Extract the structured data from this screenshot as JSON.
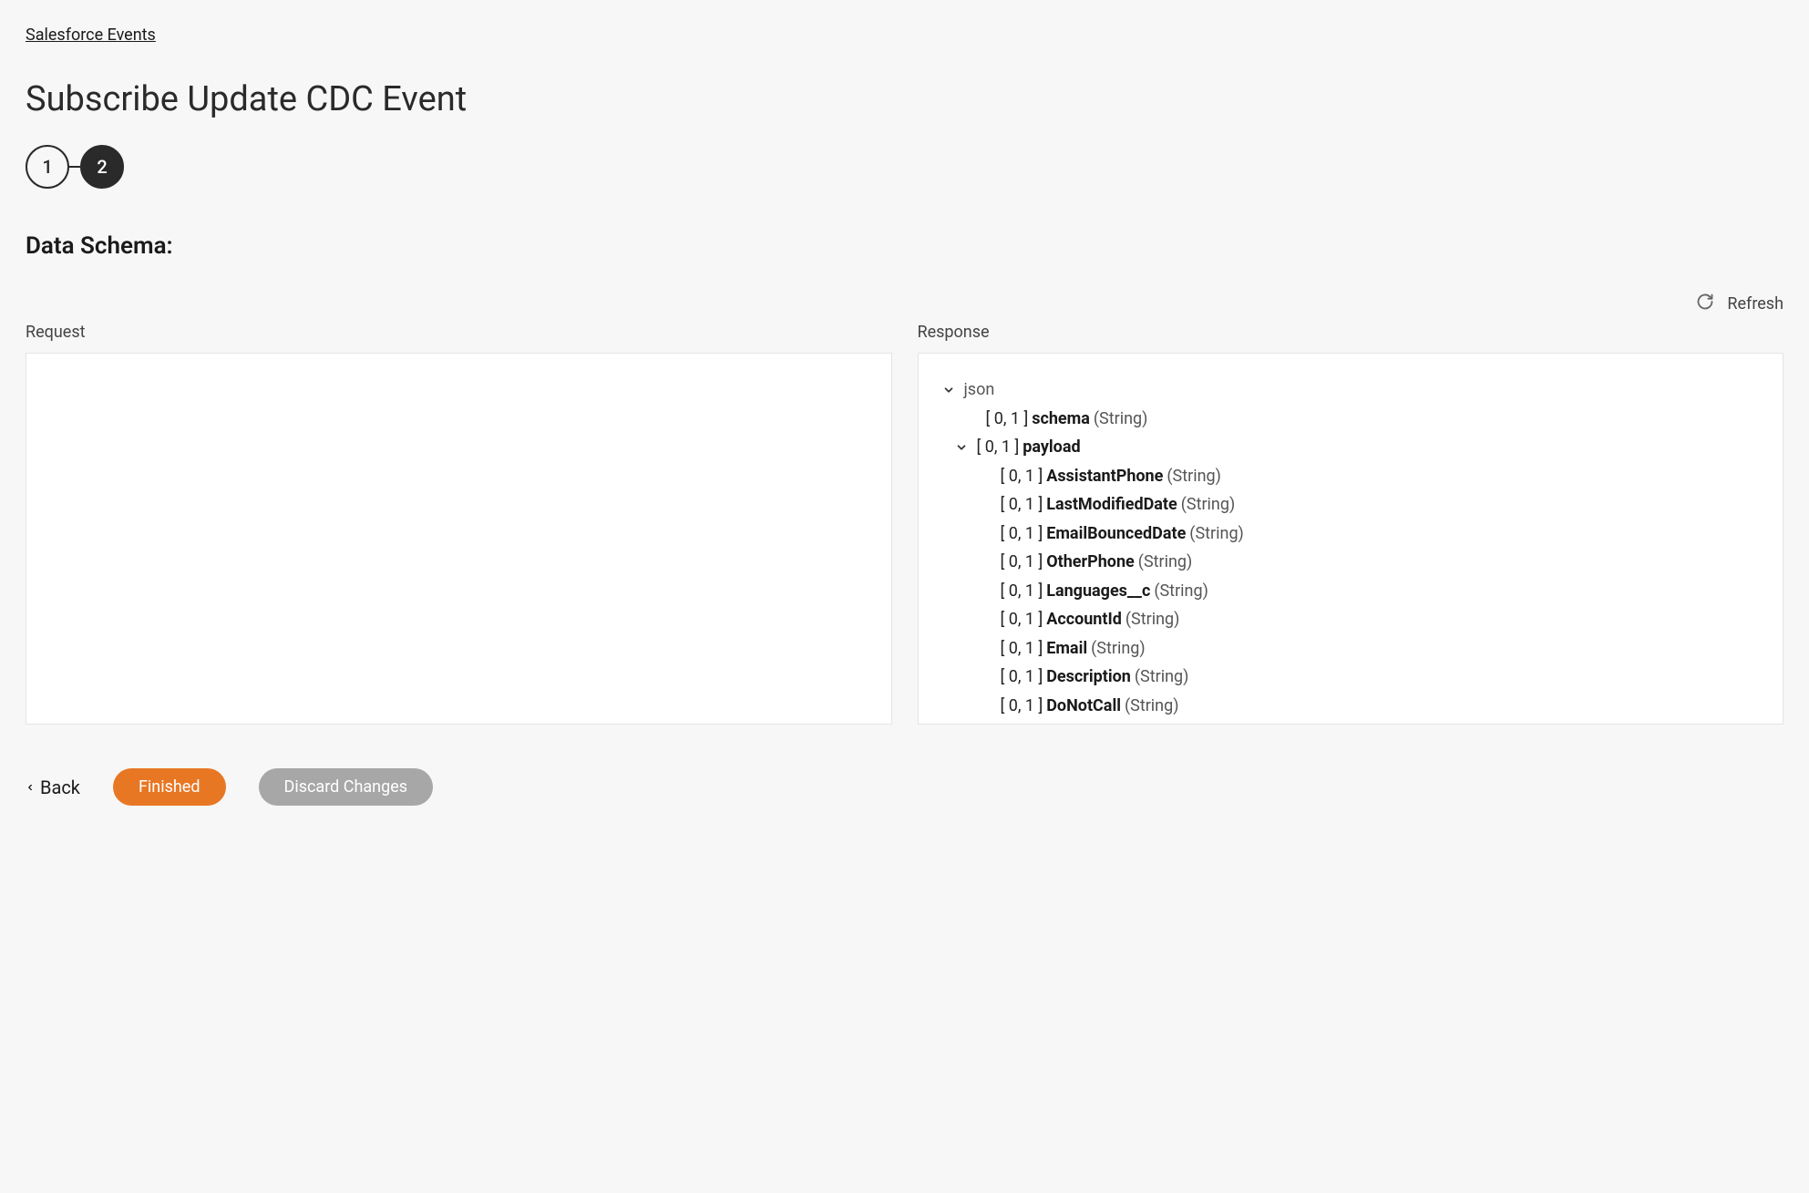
{
  "breadcrumb": {
    "label": "Salesforce Events"
  },
  "page": {
    "title": "Subscribe Update CDC Event"
  },
  "stepper": {
    "step1": "1",
    "step2": "2"
  },
  "section": {
    "label": "Data Schema:"
  },
  "refresh": {
    "label": "Refresh"
  },
  "panels": {
    "request": {
      "label": "Request"
    },
    "response": {
      "label": "Response",
      "cardinality": "[ 0, 1 ]",
      "root": "json",
      "schema_field": {
        "name": "schema",
        "type": "(String)"
      },
      "payload_field": {
        "name": "payload"
      },
      "fields": [
        {
          "name": "AssistantPhone",
          "type": "(String)"
        },
        {
          "name": "LastModifiedDate",
          "type": "(String)"
        },
        {
          "name": "EmailBouncedDate",
          "type": "(String)"
        },
        {
          "name": "OtherPhone",
          "type": "(String)"
        },
        {
          "name": "Languages__c",
          "type": "(String)"
        },
        {
          "name": "AccountId",
          "type": "(String)"
        },
        {
          "name": "Email",
          "type": "(String)"
        },
        {
          "name": "Description",
          "type": "(String)"
        },
        {
          "name": "DoNotCall",
          "type": "(String)"
        }
      ]
    }
  },
  "footer": {
    "back": "Back",
    "finished": "Finished",
    "discard": "Discard Changes"
  }
}
